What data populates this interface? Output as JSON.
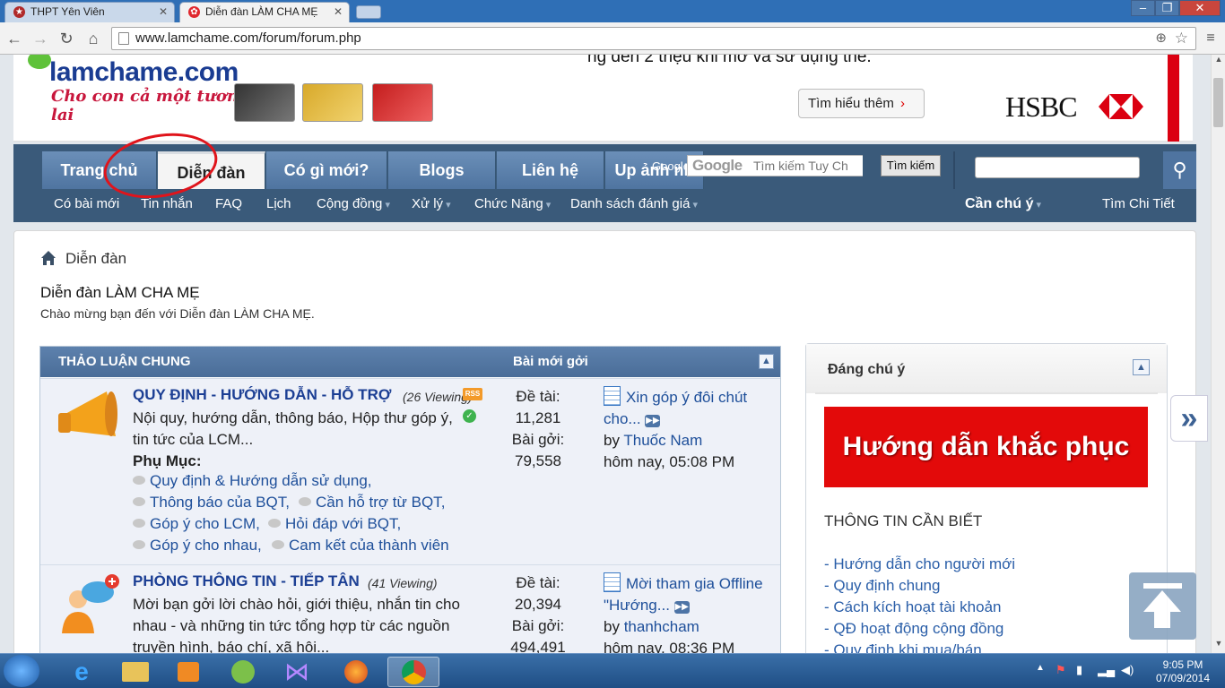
{
  "browser": {
    "tabs": [
      {
        "title": "THPT Yên Viên",
        "active": false
      },
      {
        "title": "Diễn đàn LÀM CHA MẸ",
        "active": true
      }
    ],
    "url": "www.lamchame.com/forum/forum.php",
    "window_buttons": [
      "–",
      "❐",
      "✕"
    ]
  },
  "ad": {
    "top_text": "ng đến 2 triệu khi mở và sử dụng thẻ.",
    "logo": "lamchame.com",
    "slogan": "Cho con cả một tương lai",
    "cta": "Tìm hiểu thêm",
    "brand": "HSBC"
  },
  "nav": {
    "tabs": [
      "Trang chủ",
      "Diễn đàn",
      "Có gì mới?",
      "Blogs",
      "Liên hệ",
      "Up ảnh nh"
    ],
    "active_tab": 1,
    "google_label": "Google",
    "search_placeholder": "Tìm kiếm Tuy Ch",
    "search_button": "Tìm kiếm",
    "sub": [
      "Có bài mới",
      "Tin nhắn",
      "FAQ",
      "Lịch",
      "Cộng đồng",
      "Xử lý",
      "Chức Năng",
      "Danh sách đánh giá"
    ],
    "featured": "Cần chú ý",
    "detail": "Tìm Chi Tiết"
  },
  "page": {
    "breadcrumb": "Diễn đàn",
    "title": "Diễn đàn LÀM CHA MẸ",
    "welcome": "Chào mừng bạn đến với Diễn đàn LÀM CHA MẸ."
  },
  "forum": {
    "header": "THẢO LUẬN CHUNG",
    "last_post_header": "Bài mới gởi",
    "rows": [
      {
        "title": "QUY ĐỊNH - HƯỚNG DẪN - HỖ TRỢ",
        "viewing": "(26 Viewing)",
        "desc": "Nội quy, hướng dẫn, thông báo, Hộp thư góp ý, tin tức của LCM...",
        "sub_label": "Phụ Mục:",
        "subforums": [
          "Quy định & Hướng dẫn sử dụng",
          "Thông báo của BQT",
          "Cần hỗ trợ từ BQT",
          "Góp ý cho LCM",
          "Hỏi đáp với BQT",
          "Góp ý cho nhau",
          "Cam kết của thành viên"
        ],
        "threads_label": "Đề tài:",
        "threads": "11,281",
        "posts_label": "Bài gởi:",
        "posts": "79,558",
        "last_title": "Xin góp ý đôi chút",
        "last_title2": "cho...",
        "last_by": "by",
        "last_user": "Thuốc Nam",
        "last_time": "hôm nay, 05:08 PM"
      },
      {
        "title": "PHÒNG THÔNG TIN - TIẾP TÂN",
        "viewing": "(41 Viewing)",
        "desc": "Mời bạn gởi lời chào hỏi, giới thiệu, nhắn tin cho nhau - và những tin tức tổng hợp từ các nguồn truyền hình, báo chí, xã hội...",
        "threads_label": "Đề tài:",
        "threads": "20,394",
        "posts_label": "Bài gởi:",
        "posts": "494,491",
        "last_title": "Mời tham gia Offline",
        "last_title2": "\"Hướng...",
        "last_by": "by",
        "last_user": "thanhcham",
        "last_time": "hôm nay, 08:36 PM"
      }
    ]
  },
  "sidebar": {
    "title": "Đáng chú ý",
    "banner": "Hướng dẫn khắc phục",
    "section": "THÔNG TIN CẦN BIẾT",
    "links": [
      "- Hướng dẫn cho người mới",
      "- Quy định chung",
      "- Cách kích hoạt tài khoản",
      "- QĐ hoạt động cộng đồng",
      "- Quy định khi mua/bán"
    ]
  },
  "taskbar": {
    "time": "9:05 PM",
    "date": "07/09/2014"
  }
}
